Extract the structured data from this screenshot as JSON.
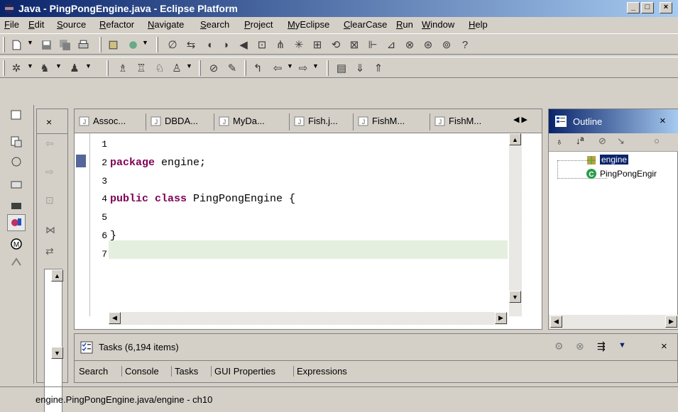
{
  "window": {
    "title": "Java - PingPongEngine.java - Eclipse Platform",
    "minimize": "_",
    "maximize": "□",
    "close": "×"
  },
  "menu": [
    "File",
    "Edit",
    "Source",
    "Refactor",
    "Navigate",
    "Search",
    "Project",
    "MyEclipse",
    "ClearCase",
    "Run",
    "Window",
    "Help"
  ],
  "editor": {
    "tabs": [
      "Assoc...",
      "DBDA...",
      "MyDa...",
      "Fish.j...",
      "FishM...",
      "FishM..."
    ],
    "tab_scroll": "◀ ▶",
    "line_numbers": [
      "1",
      "2",
      "3",
      "4",
      "5",
      "6",
      "7"
    ],
    "code_lines": [
      {
        "kw": "",
        "rest": ""
      },
      {
        "kw": "package",
        "rest": " engine;"
      },
      {
        "kw": "",
        "rest": ""
      },
      {
        "kw": "public class",
        "rest": " PingPongEngine {"
      },
      {
        "kw": "",
        "rest": ""
      },
      {
        "kw": "",
        "rest": "}"
      },
      {
        "kw": "",
        "rest": ""
      }
    ]
  },
  "outline": {
    "title": "Outline",
    "close": "×",
    "items": [
      {
        "label": "engine",
        "icon": "package-icon",
        "selected": true
      },
      {
        "label": "PingPongEngir",
        "icon": "class-icon",
        "selected": false
      }
    ]
  },
  "left_panel": {
    "close": "×"
  },
  "tasks": {
    "title": "Tasks (6,194 items)",
    "close": "×",
    "tabs": [
      "Search",
      "Console",
      "Tasks",
      "GUI Properties",
      "Expressions"
    ],
    "active_tab": "Tasks"
  },
  "status": {
    "text": "engine.PingPongEngine.java/engine - ch10"
  },
  "colors": {
    "title_start": "#0a246a",
    "title_end": "#a6caf0",
    "keyword": "#7f0055",
    "current_line": "#e5efdf"
  }
}
